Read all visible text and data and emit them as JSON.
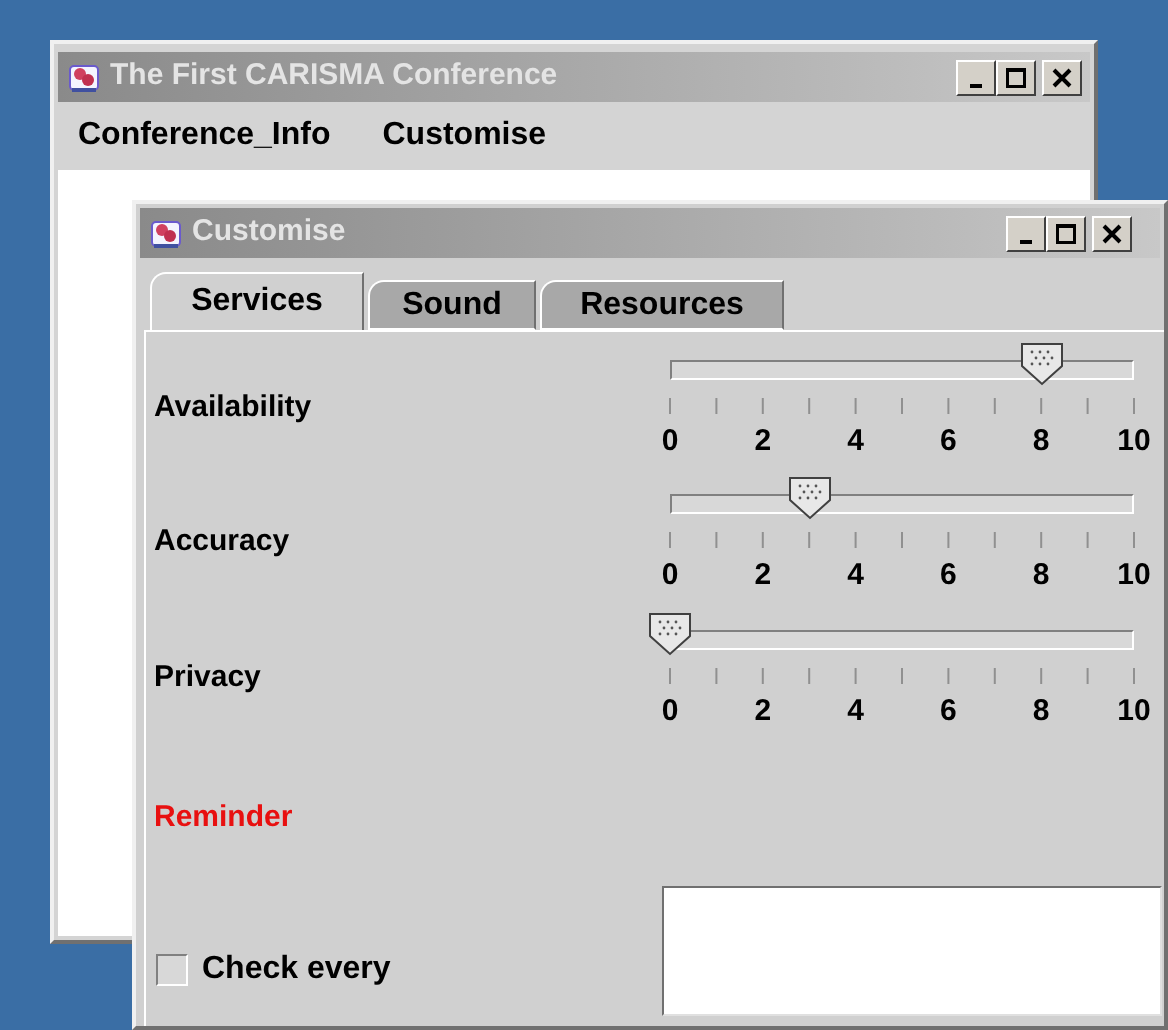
{
  "main_window": {
    "title": "The First CARISMA Conference",
    "menu": [
      {
        "label": "Conference_Info"
      },
      {
        "label": "Customise"
      }
    ]
  },
  "dialog": {
    "title": "Customise",
    "tabs": [
      {
        "label": "Services",
        "selected": true
      },
      {
        "label": "Sound",
        "selected": false
      },
      {
        "label": "Resources",
        "selected": false
      }
    ],
    "sliders": [
      {
        "label": "Availability",
        "level": 0.8,
        "tick_labels": [
          "0",
          "2",
          "4",
          "6",
          "8",
          "10"
        ]
      },
      {
        "label": "Accuracy",
        "level": 0.3,
        "tick_labels": [
          "0",
          "2",
          "4",
          "6",
          "8",
          "10"
        ]
      },
      {
        "label": "Privacy",
        "level": 0,
        "tick_labels": [
          "0",
          "2",
          "4",
          "6",
          "8",
          "10"
        ]
      }
    ],
    "heading": "Reminder",
    "check_every": {
      "label": "Check every",
      "checked": false
    }
  }
}
